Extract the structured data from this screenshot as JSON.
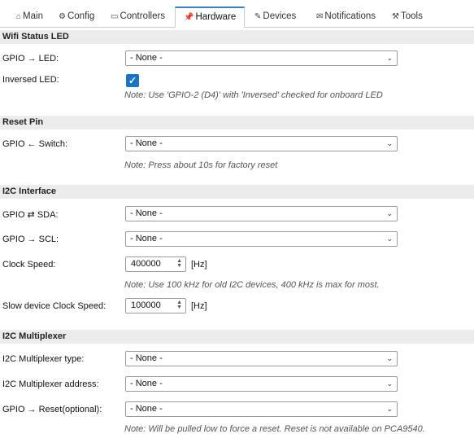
{
  "tabs": [
    {
      "label": "Main",
      "icon": "home-icon",
      "glyph": "⌂"
    },
    {
      "label": "Config",
      "icon": "gear-icon",
      "glyph": "⚙"
    },
    {
      "label": "Controllers",
      "icon": "controller-icon",
      "glyph": "▭"
    },
    {
      "label": "Hardware",
      "icon": "pin-icon",
      "glyph": "📌"
    },
    {
      "label": "Devices",
      "icon": "plug-icon",
      "glyph": "✎"
    },
    {
      "label": "Notifications",
      "icon": "envelope-icon",
      "glyph": "✉"
    },
    {
      "label": "Tools",
      "icon": "wrench-icon",
      "glyph": "⚒"
    }
  ],
  "active_tab": "Hardware",
  "wifi": {
    "title": "Wifi Status LED",
    "gpio_led_label": "GPIO → LED:",
    "gpio_led_value": "- None -",
    "inversed_label": "Inversed LED:",
    "inversed_checked": true,
    "note": "Note: Use 'GPIO-2 (D4)' with 'Inversed' checked for onboard LED"
  },
  "reset": {
    "title": "Reset Pin",
    "gpio_switch_label": "GPIO ← Switch:",
    "gpio_switch_value": "- None -",
    "note": "Note: Press about 10s for factory reset"
  },
  "i2c": {
    "title": "I2C Interface",
    "sda_label": "GPIO ⇄ SDA:",
    "sda_value": "- None -",
    "scl_label": "GPIO → SCL:",
    "scl_value": "- None -",
    "clock_label": "Clock Speed:",
    "clock_value": "400000",
    "clock_unit": "[Hz]",
    "note": "Note: Use 100 kHz for old I2C devices, 400 kHz is max for most.",
    "slow_label": "Slow device Clock Speed:",
    "slow_value": "100000",
    "slow_unit": "[Hz]"
  },
  "mux": {
    "title": "I2C Multiplexer",
    "type_label": "I2C Multiplexer type:",
    "type_value": "- None -",
    "address_label": "I2C Multiplexer address:",
    "address_value": "- None -",
    "reset_label": "GPIO → Reset(optional):",
    "reset_value": "- None -",
    "note": "Note: Will be pulled low to force a reset. Reset is not available on PCA9540."
  },
  "colors": {
    "accent": "#1a73c9",
    "section_bg": "#ececec",
    "active_pin": "#c0392b"
  }
}
